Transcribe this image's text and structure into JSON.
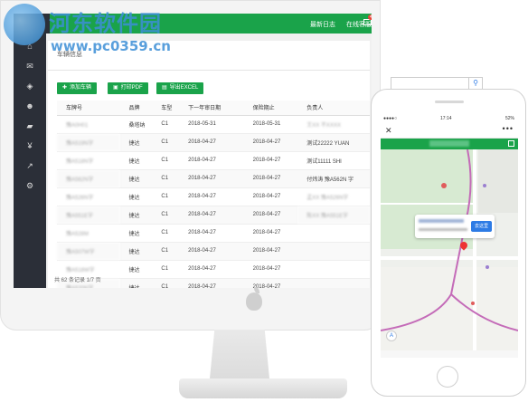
{
  "watermark": {
    "site_name": "河东软件园",
    "url": "www.pc0359.cn"
  },
  "topbar": {
    "announcements": "最新日志",
    "online": "在线客服",
    "mail_badge": "47"
  },
  "page": {
    "panel_title": "车辆信息"
  },
  "toolbar": {
    "add_label": "添加车辆",
    "print_label": "打印PDF",
    "export_label": "导出EXCEL"
  },
  "table": {
    "headers": [
      "车牌号",
      "品牌",
      "车型",
      "下一年审日期",
      "保险期止",
      "负责人"
    ],
    "rows": [
      [
        "",
        "桑塔纳",
        "C1",
        "2018-05-31",
        "2018-05-31",
        ""
      ],
      [
        "",
        "捷达",
        "C1",
        "2018-04-27",
        "2018-04-27",
        "测试22222 YUAN"
      ],
      [
        "",
        "捷达",
        "C1",
        "2018-04-27",
        "2018-04-27",
        "测试11111 SHI"
      ],
      [
        "",
        "捷达",
        "C1",
        "2018-04-27",
        "2018-04-27",
        "付炜涛 豫A562N 字"
      ],
      [
        "",
        "捷达",
        "C1",
        "2018-04-27",
        "2018-04-27",
        ""
      ],
      [
        "",
        "捷达",
        "C1",
        "2018-04-27",
        "2018-04-27",
        ""
      ],
      [
        "",
        "捷达",
        "C1",
        "2018-04-27",
        "2018-04-27",
        ""
      ],
      [
        "",
        "捷达",
        "C1",
        "2018-04-27",
        "2018-04-27",
        ""
      ],
      [
        "",
        "捷达",
        "C1",
        "2018-04-27",
        "2018-04-27",
        ""
      ],
      [
        "",
        "捷达",
        "C1",
        "2018-04-27",
        "2018-04-27",
        ""
      ]
    ]
  },
  "pagination": {
    "summary": "共 62 条记录 1/7 页"
  },
  "phone": {
    "time": "17:14",
    "battery": "52%",
    "go_here": "去这里"
  },
  "colors": {
    "accent": "#1aa34a",
    "sidebar": "#2b2f38",
    "watermark": "#3d8fd6"
  }
}
